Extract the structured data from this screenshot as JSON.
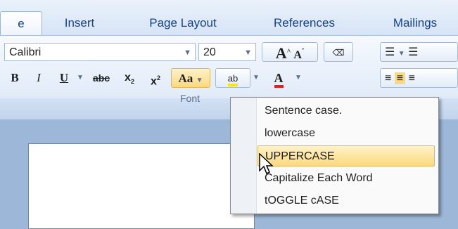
{
  "tabs": [
    {
      "label": "e"
    },
    {
      "label": "Insert"
    },
    {
      "label": "Page Layout"
    },
    {
      "label": "References"
    },
    {
      "label": "Mailings"
    }
  ],
  "font_group": {
    "font_name": "Calibri",
    "font_size": "20",
    "grow_label": "A",
    "shrink_label": "A",
    "bold": "B",
    "italic": "I",
    "underline": "U",
    "strike": "abc",
    "subscript": "x",
    "superscript": "x",
    "change_case": "Aa",
    "highlight": "ab",
    "font_color": "A",
    "group_label": "Font"
  },
  "menu": {
    "items": [
      {
        "label": "Sentence case."
      },
      {
        "label": "lowercase"
      },
      {
        "label": "UPPERCASE"
      },
      {
        "label": "Capitalize Each Word"
      },
      {
        "label": "tOGGLE cASE"
      }
    ],
    "highlighted_index": 2
  },
  "colors": {
    "accent_blue": "#15428b",
    "highlight_yellow": "#fbd97f",
    "font_color_red": "#e02020"
  }
}
